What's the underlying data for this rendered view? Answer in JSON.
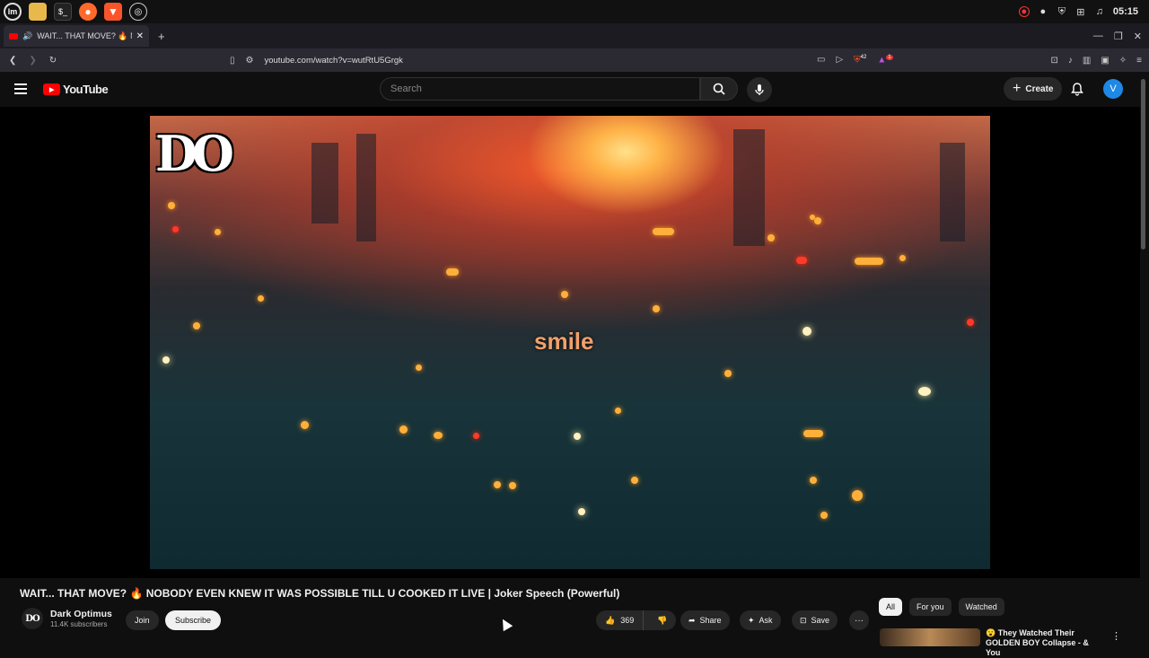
{
  "os": {
    "clock": "05:15",
    "taskbar_icons": [
      "mint-menu-icon",
      "files-icon",
      "terminal-icon",
      "firefox-icon",
      "brave-icon",
      "obs-icon"
    ]
  },
  "browser": {
    "tab_title": "WAIT... THAT MOVE? 🔥 N",
    "new_tab": "+",
    "url": "youtube.com/watch?v=wutRtU5Grgk",
    "brave_badge": "42",
    "ext_badge": "1"
  },
  "youtube": {
    "logo_text": "YouTube",
    "search_placeholder": "Search",
    "create_label": "Create",
    "avatar_letter": "V"
  },
  "video": {
    "watermark": "DO",
    "subtitle": "smile",
    "title": "WAIT... THAT MOVE? 🔥 NOBODY EVEN KNEW IT WAS POSSIBLE TILL U COOKED IT LIVE | Joker Speech (Powerful)"
  },
  "channel": {
    "avatar_text": "DO",
    "name": "Dark Optimus",
    "subscribers": "11.4K subscribers",
    "join_label": "Join",
    "subscribe_label": "Subscribe"
  },
  "actions": {
    "likes": "369",
    "share_label": "Share",
    "ask_label": "Ask",
    "save_label": "Save",
    "more_label": "···"
  },
  "chips": [
    "All",
    "For you",
    "Watched"
  ],
  "recommendation": {
    "title": "😮 They Watched Their GOLDEN BOY Collapse - & You"
  }
}
